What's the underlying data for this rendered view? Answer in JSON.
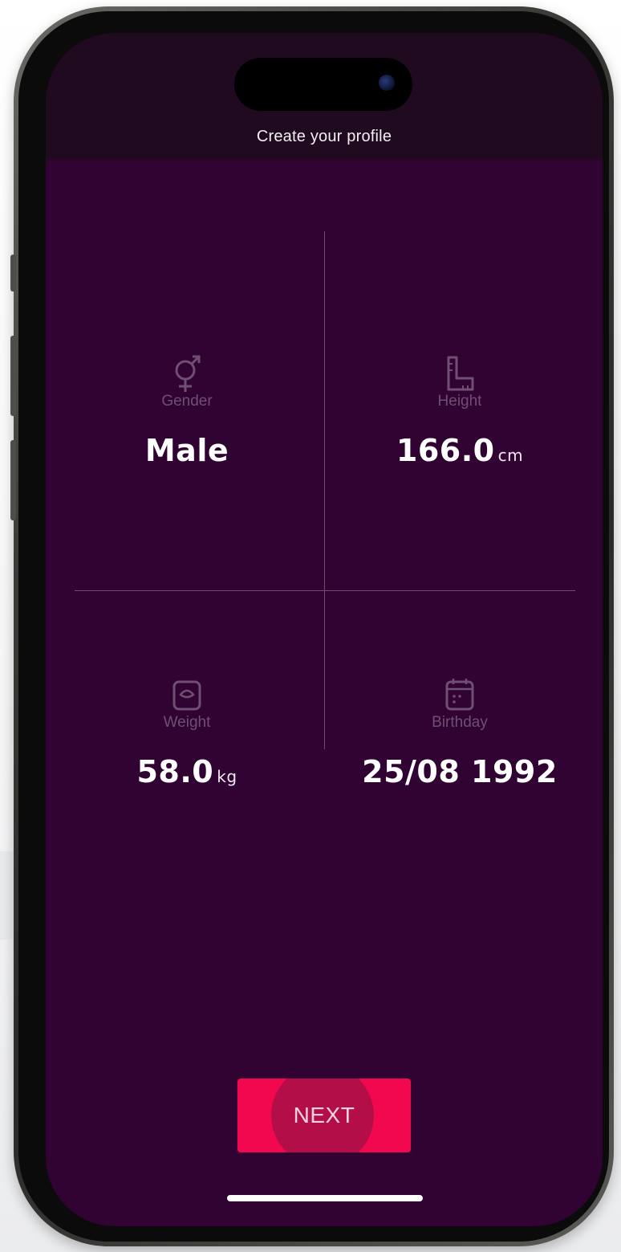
{
  "header": {
    "title": "Create your profile"
  },
  "profile": {
    "gender": {
      "label": "Gender",
      "value": "Male",
      "icon": "gender-icon"
    },
    "height": {
      "label": "Height",
      "value": "166.0",
      "unit": "cm",
      "icon": "ruler-icon"
    },
    "weight": {
      "label": "Weight",
      "value": "58.0",
      "unit": "kg",
      "icon": "scale-icon"
    },
    "birthday": {
      "label": "Birthday",
      "value": "25/08 1992",
      "icon": "calendar-icon"
    }
  },
  "actions": {
    "next_label": "NEXT"
  },
  "theme": {
    "background": "#300333",
    "status_bar": "#1f0a1f",
    "accent": "#f2084e",
    "muted_label": "#6f4f72",
    "divider": "#6e4b70"
  }
}
